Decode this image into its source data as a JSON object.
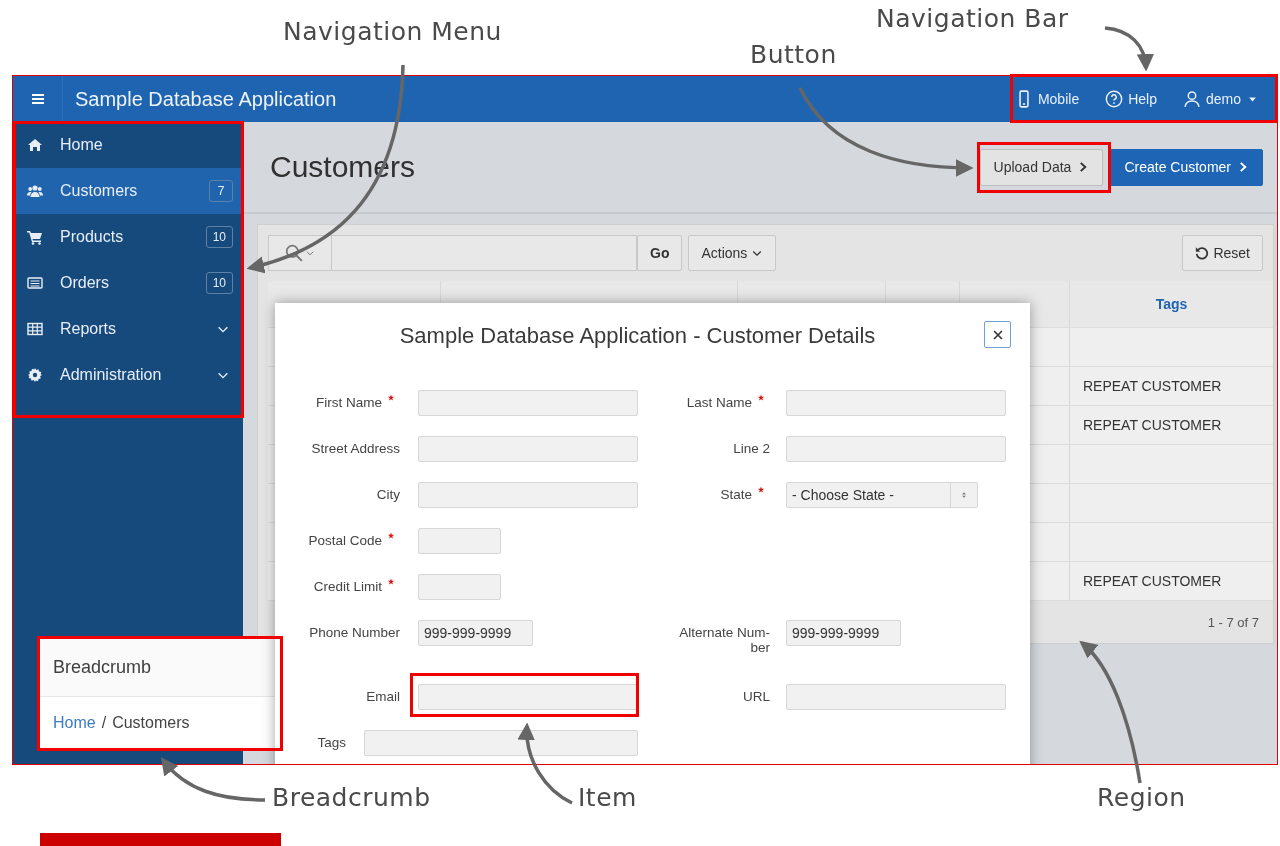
{
  "annotations": [
    {
      "text": "Navigation Menu"
    },
    {
      "text": "Navigation Bar"
    },
    {
      "text": "Button"
    },
    {
      "text": "Breadcrumb"
    },
    {
      "text": "Item"
    },
    {
      "text": "Region"
    }
  ],
  "app": {
    "title": "Sample Database Application",
    "nav_bar": [
      {
        "label": "Mobile",
        "kind": "mobile",
        "menu": false
      },
      {
        "label": "Help",
        "kind": "help",
        "menu": false
      },
      {
        "label": "demo",
        "kind": "user",
        "menu": true
      }
    ],
    "sidebar": [
      {
        "label": "Home",
        "kind": "home",
        "selected": false,
        "expandable": false
      },
      {
        "label": "Customers",
        "kind": "users",
        "badge": "7",
        "selected": true,
        "expandable": false
      },
      {
        "label": "Products",
        "kind": "cart",
        "badge": "10",
        "selected": false,
        "expandable": false
      },
      {
        "label": "Orders",
        "kind": "list",
        "badge": "10",
        "selected": false,
        "expandable": false
      },
      {
        "label": "Reports",
        "kind": "grid",
        "selected": false,
        "expandable": true
      },
      {
        "label": "Administration",
        "kind": "gear",
        "selected": false,
        "expandable": true
      }
    ],
    "page_title": "Customers",
    "buttons": [
      {
        "label": "Upload Data",
        "kind": "secondary"
      },
      {
        "label": "Create Customer",
        "kind": "primary"
      }
    ],
    "toolbar": {
      "go": "Go",
      "actions": "Actions",
      "reset": "Reset"
    },
    "table": {
      "tags_header": "Tags",
      "rows": [
        {},
        {
          "tags": "REPEAT CUSTOMER"
        },
        {
          "tags": "REPEAT CUSTOMER"
        },
        {},
        {},
        {},
        {
          "tags": "REPEAT CUSTOMER"
        }
      ],
      "pagination": "1 - 7 of 7"
    },
    "breadcrumb": {
      "title": "Breadcrumb",
      "separator": "/",
      "items": [
        {
          "label": "Home",
          "link": true
        },
        {
          "label": "Customers",
          "link": false
        }
      ]
    },
    "modal": {
      "title": "Sample Database Application - Customer Details",
      "rows": [
        [
          {
            "label": "First Name",
            "required": true,
            "kind": "wide"
          },
          {
            "label": "Last Name",
            "required": true,
            "kind": "wide"
          }
        ],
        [
          {
            "label": "Street Address",
            "required": false,
            "kind": "wide"
          },
          {
            "label": "Line 2",
            "required": false,
            "kind": "wide"
          }
        ],
        [
          {
            "label": "City",
            "required": false,
            "kind": "wide"
          },
          {
            "label": "State",
            "required": true,
            "kind": "select",
            "value": "- Choose State -"
          }
        ],
        [
          {
            "label": "Postal Code",
            "required": true,
            "kind": "small"
          }
        ],
        [
          {
            "label": "Credit Limit",
            "required": true,
            "kind": "small"
          }
        ],
        [
          {
            "label": "Phone Number",
            "required": false,
            "kind": "medium",
            "value": "999-999-9999"
          },
          {
            "label": "Alternate Num-ber",
            "required": false,
            "kind": "medium",
            "value": "999-999-9999"
          }
        ],
        [
          {
            "label": "Email",
            "required": false,
            "kind": "wide"
          },
          {
            "label": "URL",
            "required": false,
            "kind": "wide"
          }
        ],
        [
          {
            "label": "Tags",
            "required": false,
            "kind": "full"
          }
        ]
      ]
    }
  }
}
